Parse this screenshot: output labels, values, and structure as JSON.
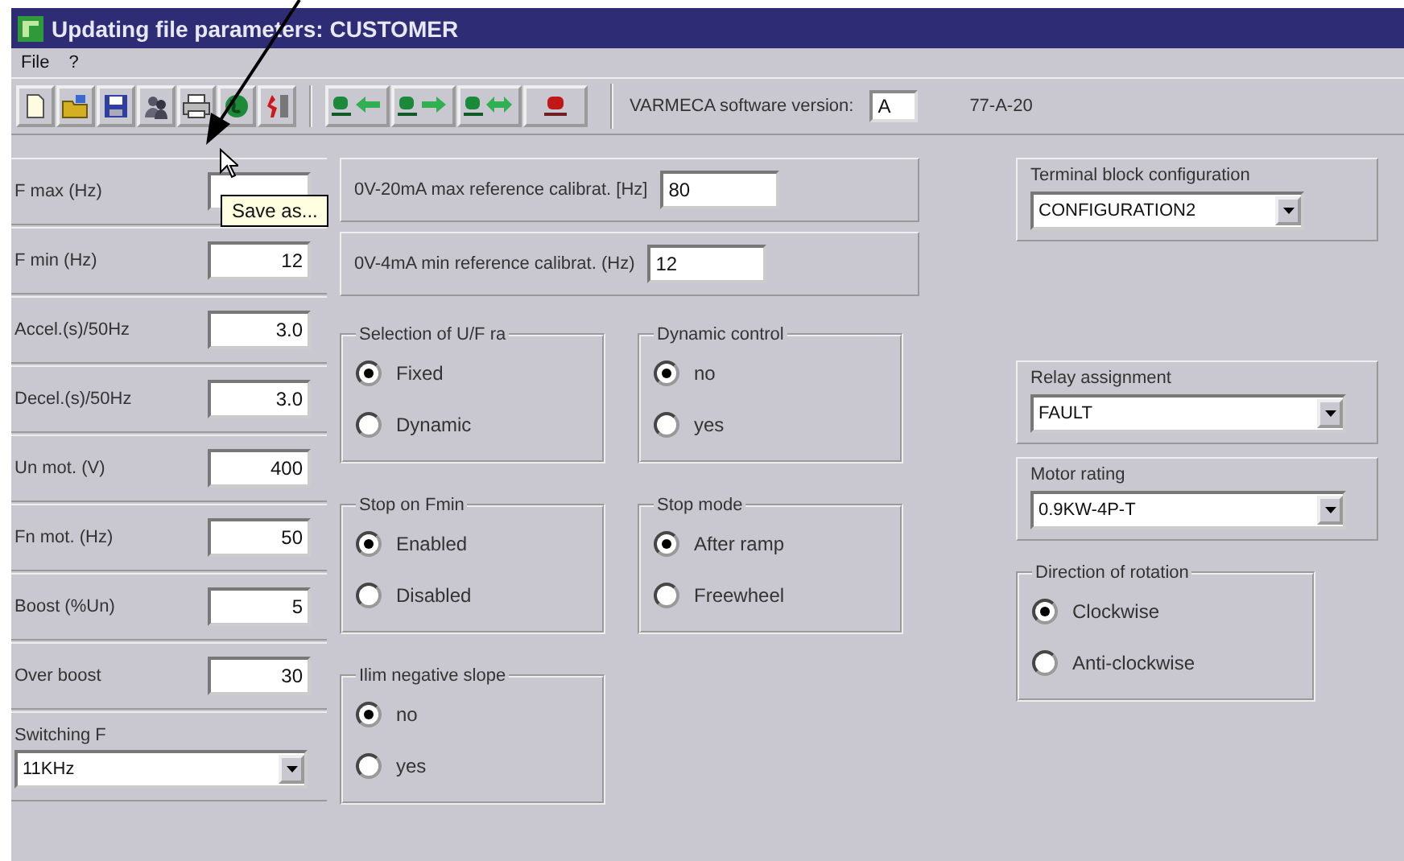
{
  "window": {
    "title": "Updating file parameters: CUSTOMER"
  },
  "menu": [
    "File",
    "?"
  ],
  "version": {
    "label": "VARMECA software version:",
    "value": "A",
    "code": "77-A-20"
  },
  "tooltip": "Save as...",
  "parameters": [
    {
      "label": "F max (Hz)"
    },
    {
      "label": "F min (Hz)",
      "value": "12"
    },
    {
      "label": "Accel.(s)/50Hz",
      "value": "3.0"
    },
    {
      "label": "Decel.(s)/50Hz",
      "value": "3.0"
    },
    {
      "label": "Un mot. (V)",
      "value": "400"
    },
    {
      "label": "Fn mot. (Hz)",
      "value": "50"
    },
    {
      "label": "Boost (%Un)",
      "value": "5"
    },
    {
      "label": "Over boost",
      "value": "30"
    }
  ],
  "switching": {
    "label": "Switching F",
    "value": "11KHz"
  },
  "calibration": [
    {
      "label": "0V-20mA max reference calibrat. [Hz]",
      "value": "80"
    },
    {
      "label": "0V-4mA min reference calibrat. (Hz)",
      "value": "12"
    }
  ],
  "option_groups": [
    {
      "title": "Selection of U/F ra",
      "options": [
        {
          "label": "Fixed",
          "selected": true
        },
        {
          "label": "Dynamic",
          "selected": false
        }
      ]
    },
    {
      "title": "Dynamic control",
      "options": [
        {
          "label": "no",
          "selected": true
        },
        {
          "label": "yes",
          "selected": false
        }
      ]
    },
    {
      "title": "Stop on Fmin",
      "options": [
        {
          "label": "Enabled",
          "selected": true
        },
        {
          "label": "Disabled",
          "selected": false
        }
      ]
    },
    {
      "title": "Stop mode",
      "options": [
        {
          "label": "After ramp",
          "selected": true
        },
        {
          "label": "Freewheel",
          "selected": false
        }
      ]
    },
    {
      "title": "Ilim negative slope",
      "options": [
        {
          "label": "no",
          "selected": true
        },
        {
          "label": "yes",
          "selected": false
        }
      ]
    }
  ],
  "terminal": {
    "label": "Terminal block configuration",
    "value": "CONFIGURATION2"
  },
  "selects": [
    {
      "label": "Relay assignment",
      "value": "FAULT"
    },
    {
      "label": "Motor rating",
      "value": "0.9KW-4P-T"
    }
  ],
  "rotation": {
    "title": "Direction of rotation",
    "options": [
      {
        "label": "Clockwise",
        "selected": true
      },
      {
        "label": "Anti-clockwise",
        "selected": false
      }
    ]
  }
}
